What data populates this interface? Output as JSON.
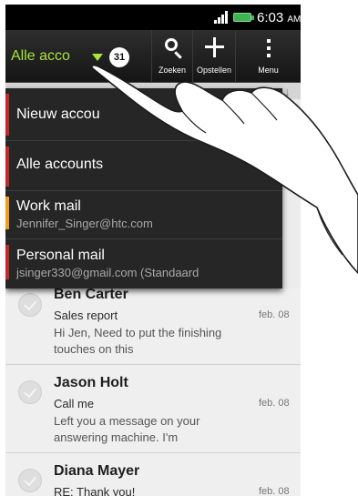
{
  "status_bar": {
    "time": "6:03",
    "ampm": "AM"
  },
  "action_bar": {
    "account_title": "Alle acco",
    "unread_count": "31",
    "search_label": "Zoeken",
    "compose_label": "Opstellen",
    "menu_label": "Menu"
  },
  "dropdown": {
    "items": [
      {
        "label": "Nieuw accou",
        "sublabel": "",
        "color": "#c62828"
      },
      {
        "label": "Alle accounts",
        "sublabel": "",
        "color": "#c62828"
      },
      {
        "label": "Work mail",
        "sublabel": "Jennifer_Singer@htc.com",
        "color": "#f29a1e"
      },
      {
        "label": "Personal mail",
        "sublabel": "jsinger330@gmail.com (Standaard",
        "color": "#c62828"
      }
    ]
  },
  "emails": [
    {
      "sender": "Ben Carter",
      "subject": "Sales report",
      "date": "feb. 08",
      "preview": "Hi Jen,  Need to put the finishing touches on this"
    },
    {
      "sender": "Jason Holt",
      "subject": "Call me",
      "date": "feb. 08",
      "preview": "Left you a message on your answering machine. I'm"
    },
    {
      "sender": "Diana Mayer",
      "subject": "RE: Thank you!",
      "date": "feb. 08",
      "preview": ""
    }
  ],
  "colors": {
    "accent": "#a8e63a",
    "work_account": "#f29a1e",
    "personal_account": "#c62828"
  }
}
